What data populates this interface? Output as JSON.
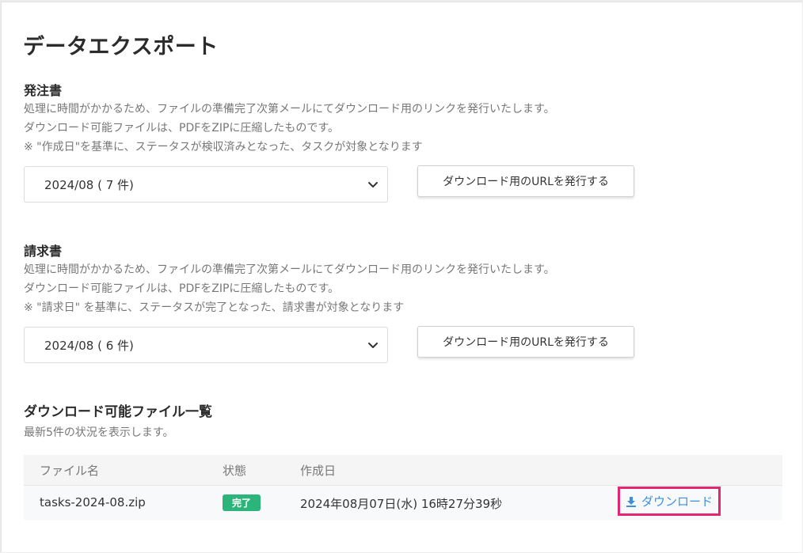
{
  "page": {
    "title": "データエクスポート"
  },
  "purchase_orders": {
    "title": "発注書",
    "desc1": "処理に時間がかかるため、ファイルの準備完了次第メールにてダウンロード用のリンクを発行いたします。",
    "desc2": "ダウンロード可能ファイルは、PDFをZIPに圧縮したものです。",
    "desc3": "※ \"作成日\"を基準に、ステータスが検収済みとなった、タスクが対象となります",
    "select_value": "2024/08 ( 7 件)",
    "button_label": "ダウンロード用のURLを発行する"
  },
  "invoices": {
    "title": "請求書",
    "desc1": "処理に時間がかかるため、ファイルの準備完了次第メールにてダウンロード用のリンクを発行いたします。",
    "desc2": "ダウンロード可能ファイルは、PDFをZIPに圧縮したものです。",
    "desc3": "※ \"請求日\" を基準に、ステータスが完了となった、請求書が対象となります",
    "select_value": "2024/08 ( 6 件)",
    "button_label": "ダウンロード用のURLを発行する"
  },
  "files": {
    "title": "ダウンロード可能ファイル一覧",
    "subtitle": "最新5件の状況を表示します。",
    "headers": {
      "name": "ファイル名",
      "status": "状態",
      "created": "作成日"
    },
    "rows": [
      {
        "name": "tasks-2024-08.zip",
        "status": "完了",
        "created": "2024年08月07日(水) 16時27分39秒",
        "action": "ダウンロード"
      }
    ]
  },
  "colors": {
    "status_complete": "#2cb57a",
    "link": "#3d8fe0",
    "highlight_border": "#e5256f"
  },
  "icons": {
    "select_chevron": "chevron-down-icon",
    "download": "download-icon"
  }
}
